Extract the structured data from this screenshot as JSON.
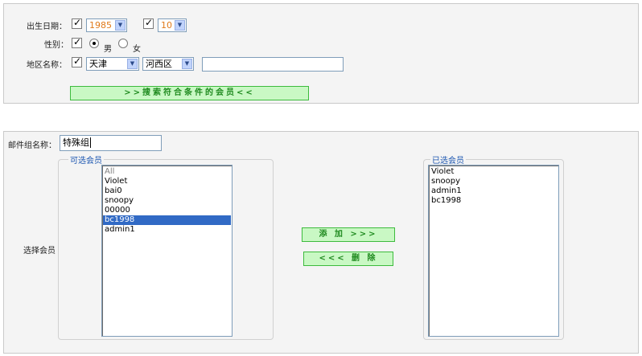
{
  "search_panel": {
    "birth_date": {
      "label": "出生日期：",
      "year": "1985",
      "month": "10"
    },
    "gender": {
      "label": "性别：",
      "male": "男",
      "female": "女",
      "selected": "男"
    },
    "region": {
      "label": "地区名称：",
      "city": "天津",
      "district": "河西区",
      "text_value": ""
    },
    "search_button_label": ">>搜索符合条件的会员<<"
  },
  "mail_group_panel": {
    "group_name_label": "邮件组名称：",
    "group_name_value": "特殊组",
    "select_members_label": "选择会员",
    "available": {
      "legend": "可选会员",
      "items": [
        "All",
        "Violet",
        "bai0",
        "snoopy",
        "00000",
        "bc1998",
        "admin1"
      ],
      "selected_item": "bc1998"
    },
    "chosen": {
      "legend": "已选会员",
      "items": [
        "Violet",
        "snoopy",
        "admin1",
        "bc1998"
      ]
    },
    "add_button_label": "添 加 >>>",
    "remove_button_label": "<<< 删 除"
  },
  "colors": {
    "panel_bg": "#f4f4f4",
    "button_bg": "#c9f8c4",
    "button_text": "#1f8a1f",
    "legend_text": "#1a55b0",
    "selection_bg": "#316ac5",
    "dropdown_value": "#e07a1a"
  }
}
